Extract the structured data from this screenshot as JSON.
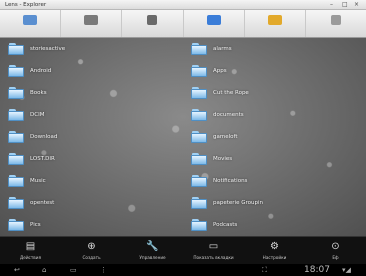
{
  "window": {
    "title": "Lens - Explorer",
    "controls": [
      "–",
      "□",
      "×"
    ]
  },
  "toolbar": [
    {
      "icon": "home-icon",
      "label": "",
      "color": "#5a8fd0"
    },
    {
      "icon": "up-folder-icon",
      "label": "",
      "color": "#7a7a7a"
    },
    {
      "icon": "share-icon",
      "label": "",
      "color": "#6a6a6a"
    },
    {
      "icon": "favorites-icon",
      "label": "",
      "color": "#3b7dd8"
    },
    {
      "icon": "bookmark-icon",
      "label": "",
      "color": "#e2a92b"
    },
    {
      "icon": "settings-icon",
      "label": "",
      "color": "#9a9a9a"
    }
  ],
  "folders_left": [
    "storiesactive",
    "Android",
    "Books",
    "DCIM",
    "Download",
    "LOST.DIR",
    "Music",
    "opentest",
    "Pics"
  ],
  "folders_right": [
    "alarms",
    "Apps",
    "Cut the Rope",
    "documents",
    "gameloft",
    "Movies",
    "Notifications",
    "papeterie Groupin",
    "Podcasts"
  ],
  "actions": [
    {
      "icon": "actions-icon",
      "glyph": "▤",
      "label": "Действия"
    },
    {
      "icon": "create-icon",
      "glyph": "⊕",
      "label": "Создать"
    },
    {
      "icon": "wrench-icon",
      "glyph": "🔧",
      "label": "Управление"
    },
    {
      "icon": "folder-icon",
      "glyph": "▭",
      "label": "Показать вкладки"
    },
    {
      "icon": "gear-icon",
      "glyph": "⚙",
      "label": "Настройки"
    },
    {
      "icon": "exit-icon",
      "glyph": "⊙",
      "label": "Eф"
    }
  ],
  "statusbar": {
    "back": "↩",
    "home": "⌂",
    "recent": "▭",
    "menu": "⋮",
    "screenshot": "⛶",
    "time": "18:07",
    "signal": "▾◢"
  }
}
